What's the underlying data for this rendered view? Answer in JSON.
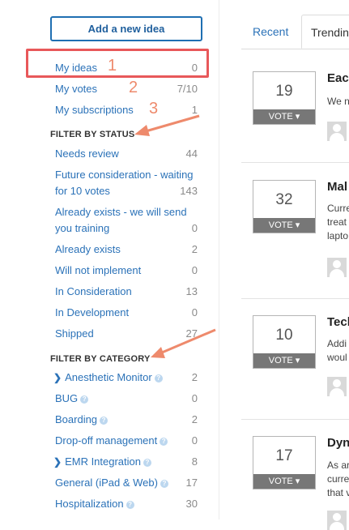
{
  "sidebar": {
    "add_button": "Add a new idea",
    "my_items": [
      {
        "label": "My ideas",
        "count": "0"
      },
      {
        "label": "My votes",
        "count": "7/10"
      },
      {
        "label": "My subscriptions",
        "count": "1"
      }
    ],
    "status_heading": "FILTER BY STATUS",
    "status_items": [
      {
        "label": "Needs review",
        "count": "44"
      },
      {
        "label": "Future consideration - waiting for 10 votes",
        "line1": "Future consideration - waiting",
        "line2": "for 10 votes",
        "count": "143"
      },
      {
        "label": "Already exists - we will send you training",
        "line1": "Already exists - we will send",
        "line2": "you training",
        "count": "0"
      },
      {
        "label": "Already exists",
        "count": "2"
      },
      {
        "label": "Will not implement",
        "count": "0"
      },
      {
        "label": "In Consideration",
        "count": "13"
      },
      {
        "label": "In Development",
        "count": "0"
      },
      {
        "label": "Shipped",
        "count": "27"
      }
    ],
    "category_heading": "FILTER BY CATEGORY",
    "category_items": [
      {
        "label": "Anesthetic Monitor",
        "count": "2",
        "expandable": true
      },
      {
        "label": "BUG",
        "count": "0"
      },
      {
        "label": "Boarding",
        "count": "2"
      },
      {
        "label": "Drop-off management",
        "count": "0"
      },
      {
        "label": "EMR Integration",
        "count": "8",
        "expandable": true
      },
      {
        "label": "General (iPad & Web)",
        "count": "17"
      },
      {
        "label": "Hospitalization",
        "count": "30"
      }
    ]
  },
  "annotations": {
    "n1": "1",
    "n2": "2",
    "n3": "3",
    "highlight_color": "#e8585a",
    "arrow_color": "#ee8a6c"
  },
  "tabs": [
    {
      "label": "Recent",
      "active": false
    },
    {
      "label": "Trendin",
      "active": true
    }
  ],
  "ideas": [
    {
      "votes": "19",
      "vote_label": "VOTE ▾",
      "title": "Each",
      "desc": [
        "We n"
      ]
    },
    {
      "votes": "32",
      "vote_label": "VOTE ▾",
      "title": "Mal",
      "desc": [
        "Curre",
        "treat",
        "lapto"
      ]
    },
    {
      "votes": "10",
      "vote_label": "VOTE ▾",
      "title": "Tech",
      "desc": [
        "Addi",
        "woul"
      ]
    },
    {
      "votes": "17",
      "vote_label": "VOTE ▾",
      "title": "Dyn",
      "desc": [
        "As ar",
        "curre",
        "that v"
      ]
    }
  ]
}
